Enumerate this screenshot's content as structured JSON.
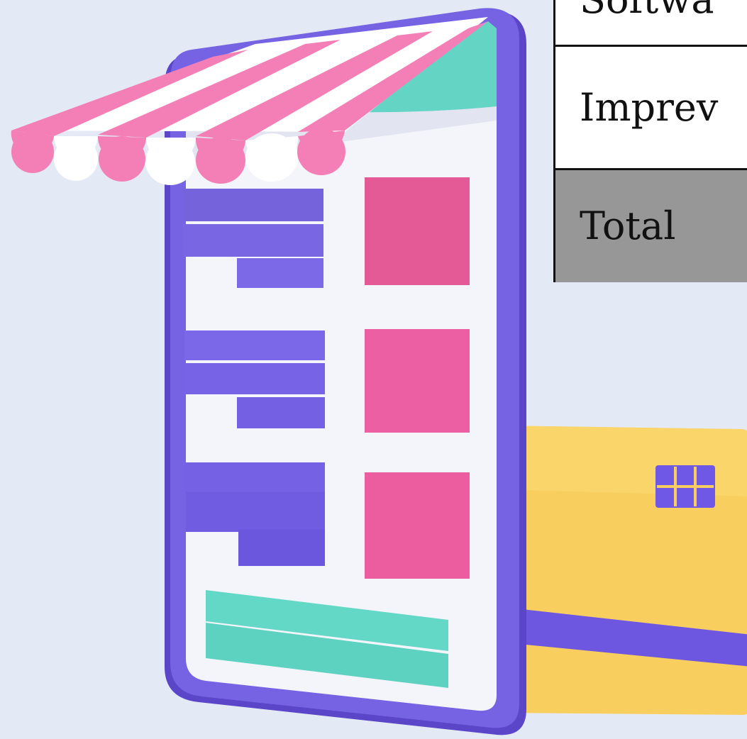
{
  "table": {
    "rows": [
      {
        "label": "Softwa"
      },
      {
        "label": "Imprev"
      },
      {
        "label": "Total"
      }
    ]
  },
  "colors": {
    "background": "#e4e9f6",
    "phone_frame": "#6a55d6",
    "phone_screen": "#f4f5fb",
    "awning_pink": "#f47fb6",
    "awning_white": "#ffffff",
    "awning_teal": "#64d4c4",
    "list_bar": "#7b68e6",
    "product_tile": "#ec5f9f",
    "checkout_bar": "#64d8c6",
    "card": "#f8cf5f",
    "card_stripe": "#6d56e0",
    "card_chip": "#6f58e6",
    "total_row": "#979797"
  },
  "icons": [
    "shop-awning-icon",
    "credit-card-icon",
    "card-chip-icon"
  ]
}
